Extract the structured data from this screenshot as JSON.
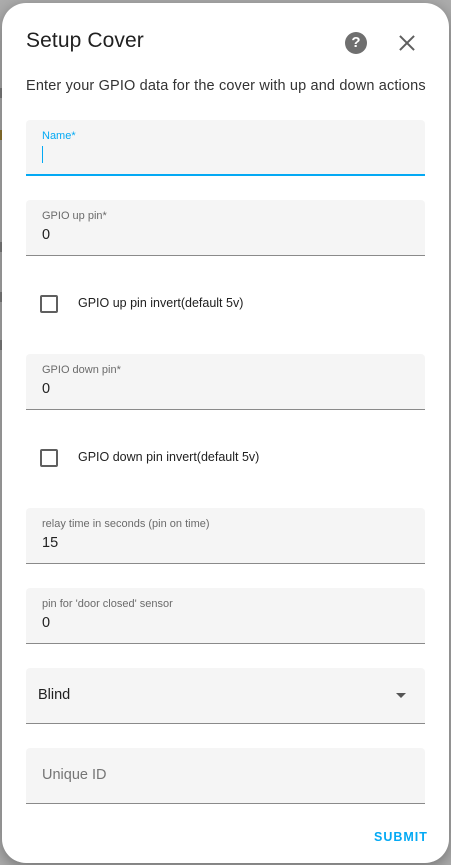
{
  "dialog": {
    "title": "Setup Cover",
    "help_icon": "help-circle-icon",
    "help_glyph": "?",
    "close_icon": "close-icon",
    "subtitle": "Enter your GPIO data for the cover with up and down actions"
  },
  "form": {
    "name": {
      "label": "Name*",
      "value": ""
    },
    "gpio_up_pin": {
      "label": "GPIO up pin*",
      "value": "0"
    },
    "gpio_up_invert": {
      "label": "GPIO up pin invert(default 5v)",
      "checked": false
    },
    "gpio_down_pin": {
      "label": "GPIO down pin*",
      "value": "0"
    },
    "gpio_down_invert": {
      "label": "GPIO down pin invert(default 5v)",
      "checked": false
    },
    "relay_time": {
      "label": "relay time in seconds (pin on time)",
      "value": "15"
    },
    "door_closed_pin": {
      "label": "pin for 'door closed' sensor",
      "value": "0"
    },
    "device_class": {
      "selected": "Blind"
    },
    "unique_id": {
      "placeholder": "Unique ID",
      "value": ""
    }
  },
  "actions": {
    "submit_label": "SUBMIT"
  },
  "colors": {
    "accent": "#03a9f4",
    "text": "#212121",
    "field_bg": "#f5f5f5"
  }
}
